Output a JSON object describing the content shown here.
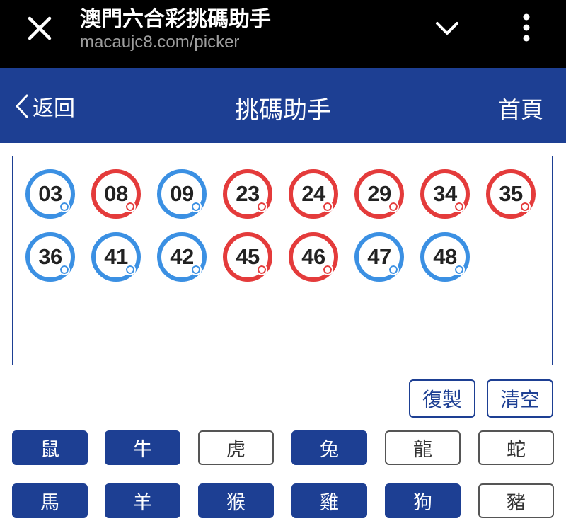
{
  "browser": {
    "title": "澳門六合彩挑碼助手",
    "url": "macaujc8.com/picker"
  },
  "appbar": {
    "back_label": "返回",
    "title": "挑碼助手",
    "home_label": "首頁"
  },
  "selected_numbers": [
    {
      "value": "03",
      "color": "blue"
    },
    {
      "value": "08",
      "color": "red"
    },
    {
      "value": "09",
      "color": "blue"
    },
    {
      "value": "23",
      "color": "red"
    },
    {
      "value": "24",
      "color": "red"
    },
    {
      "value": "29",
      "color": "red"
    },
    {
      "value": "34",
      "color": "red"
    },
    {
      "value": "35",
      "color": "red"
    },
    {
      "value": "36",
      "color": "blue"
    },
    {
      "value": "41",
      "color": "blue"
    },
    {
      "value": "42",
      "color": "blue"
    },
    {
      "value": "45",
      "color": "red"
    },
    {
      "value": "46",
      "color": "red"
    },
    {
      "value": "47",
      "color": "blue"
    },
    {
      "value": "48",
      "color": "blue"
    }
  ],
  "actions": {
    "copy_label": "復製",
    "clear_label": "清空"
  },
  "zodiac": [
    {
      "label": "鼠",
      "selected": true
    },
    {
      "label": "牛",
      "selected": true
    },
    {
      "label": "虎",
      "selected": false
    },
    {
      "label": "兔",
      "selected": true
    },
    {
      "label": "龍",
      "selected": false
    },
    {
      "label": "蛇",
      "selected": false
    },
    {
      "label": "馬",
      "selected": true
    },
    {
      "label": "羊",
      "selected": true
    },
    {
      "label": "猴",
      "selected": true
    },
    {
      "label": "雞",
      "selected": true
    },
    {
      "label": "狗",
      "selected": true
    },
    {
      "label": "豬",
      "selected": false
    }
  ],
  "colors": {
    "brand_blue": "#1d3f93",
    "ball_blue": "#3b90e3",
    "ball_red": "#e43b3b"
  }
}
